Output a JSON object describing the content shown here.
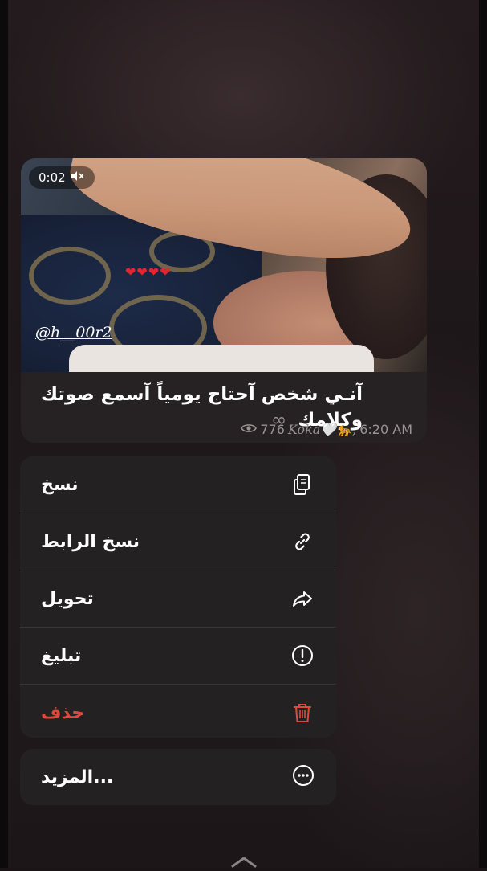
{
  "message": {
    "video_time": "0:02",
    "mute_icon": "speaker-muted-icon",
    "hearts": "❤❤❤❤",
    "watermark": "@h__00r2",
    "caption": "آنـي شخص آحتاج يومياً آسمع صوتك وكلامك",
    "caption_suffix": "∞",
    "views": "776",
    "signature": "Koka🤍🐆,",
    "time": "6:20 AM"
  },
  "menu": {
    "items": [
      {
        "label": "نسخ",
        "icon": "copy-icon"
      },
      {
        "label": "نسخ الرابط",
        "icon": "link-icon"
      },
      {
        "label": "تحويل",
        "icon": "forward-icon"
      },
      {
        "label": "تبليغ",
        "icon": "report-icon"
      },
      {
        "label": "حذف",
        "icon": "trash-icon"
      }
    ],
    "more": {
      "label": "المزيد...",
      "icon": "more-icon"
    }
  },
  "colors": {
    "danger": "#e1483d",
    "menu_bg": "#242122",
    "text": "#ffffff",
    "secondary": "#9a9495"
  }
}
